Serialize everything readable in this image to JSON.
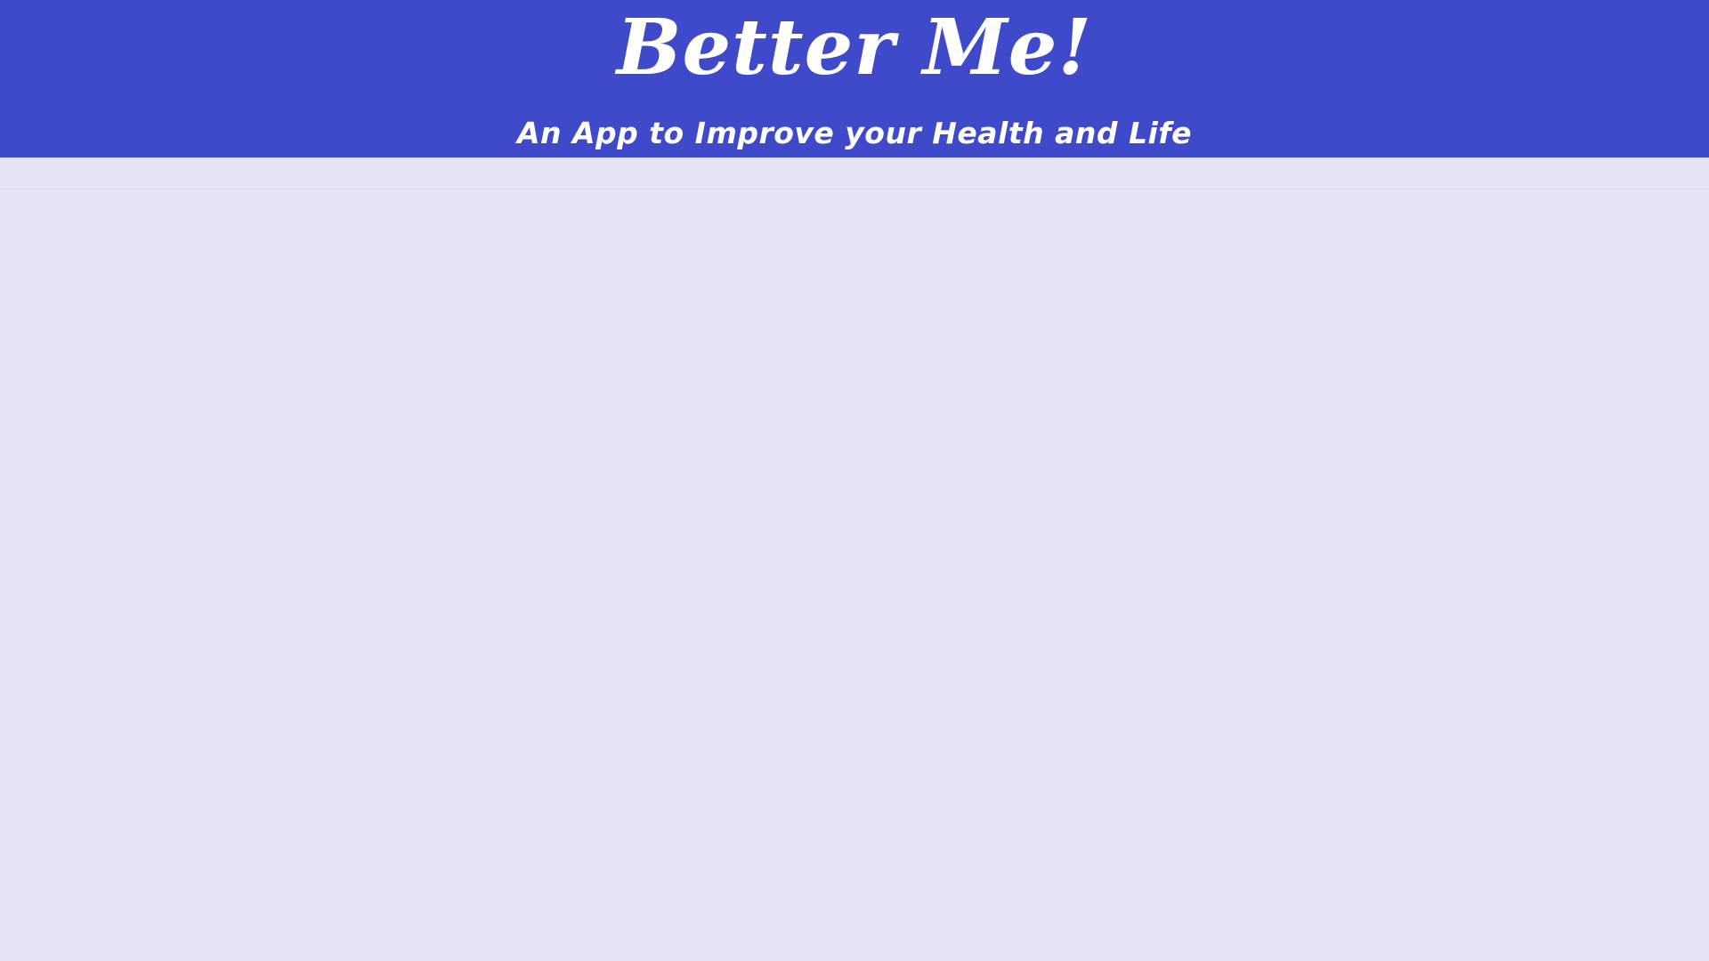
{
  "header": {
    "title": "Better Me!",
    "subtitle": "An App to Improve your Health and Life"
  },
  "colors": {
    "header_background": "#3f4acb",
    "page_background": "#e7e3f4",
    "header_text": "#ffffff"
  }
}
